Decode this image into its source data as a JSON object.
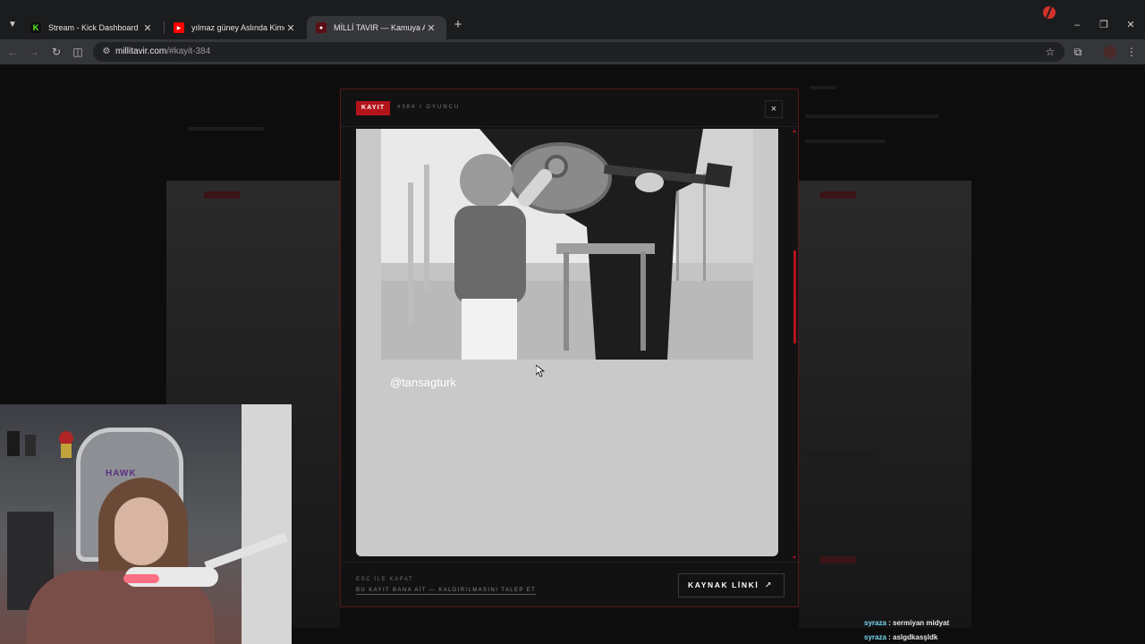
{
  "browser": {
    "tabs": [
      {
        "title": "Stream - Kick Dashboard",
        "favicon": "kick-icon",
        "active": false
      },
      {
        "title": "yılmaz güney Aslında Kimdi? | Y",
        "favicon": "youtube-icon",
        "active": false
      },
      {
        "title": "MİLLİ TAVIR — Kamuya Açık Pe",
        "favicon": "site-icon",
        "active": true
      }
    ],
    "new_tab_label": "+",
    "url_host": "millitavir.com",
    "url_path": "/#kayit-384"
  },
  "modal": {
    "badge": "KAYIT",
    "breadcrumb": "#384 / OYUNCU",
    "close_label": "×",
    "handle": "@tansagturk",
    "footer_hint": "ESC İLE KAPAT",
    "claim_link": "BU KAYIT BANA AİT — KALDIRILMASINI TALEP ET",
    "source_button": "KAYNAK LİNKİ",
    "source_arrow": "↗"
  },
  "webcam": {
    "chair_brand": "HAWK"
  },
  "chat": [
    {
      "user": "syraza",
      "message": "sermiyan midyat"
    },
    {
      "user": "syraza",
      "message": "aslgdkasşldk"
    }
  ],
  "colors": {
    "accent": "#b3141c",
    "modal_bg": "#121213",
    "chat_user": "#7ad7f0"
  }
}
